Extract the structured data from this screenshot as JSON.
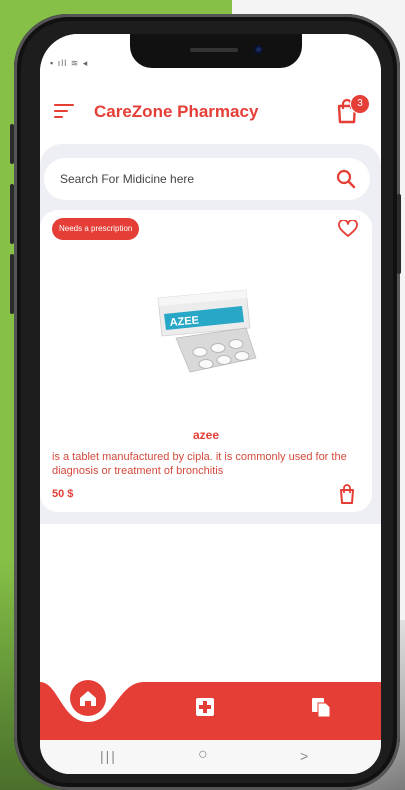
{
  "app": {
    "title": "CareZone Pharmacy",
    "cart_count": "3"
  },
  "search": {
    "placeholder": "Search For Midicine here"
  },
  "product": {
    "badge": "Needs a prescription",
    "name": "azee",
    "description": "is a tablet manufactured by cipla. it is commonly used for the diagnosis or treatment of bronchitis",
    "price": "50 $",
    "package_label": "AZEE"
  },
  "system_nav": {
    "recent": "|||",
    "home": "○",
    "back": ">"
  },
  "colors": {
    "accent": "#e53e36",
    "background_green": "#86c047",
    "content_bg": "#eeeff4"
  },
  "icons": [
    "menu-icon",
    "cart-icon",
    "search-icon",
    "heart-icon",
    "bag-icon",
    "home-icon",
    "medical-icon",
    "documents-icon"
  ]
}
